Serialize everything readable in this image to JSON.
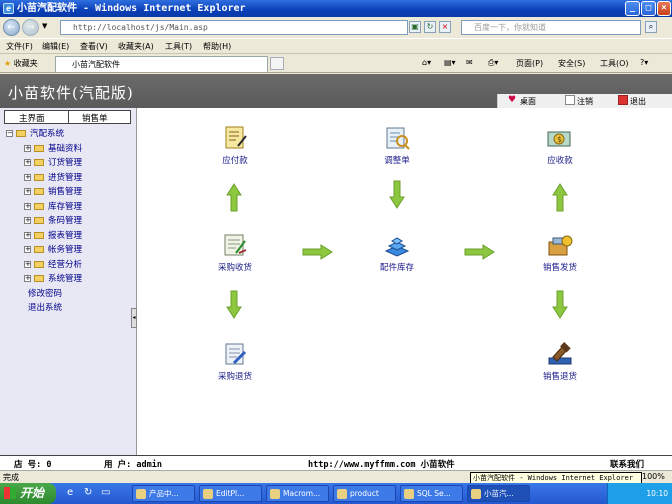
{
  "window": {
    "title": "小苗汽配软件 - Windows Internet Explorer"
  },
  "address": {
    "url": "http://localhost/js/Main.asp",
    "search_placeholder": "百度一下，你就知道"
  },
  "menu": [
    "文件(F)",
    "编辑(E)",
    "查看(V)",
    "收藏夹(A)",
    "工具(T)",
    "帮助(H)"
  ],
  "favorites": {
    "label": "收藏夹",
    "tab_title": "小苗汽配软件"
  },
  "commands": {
    "page": "页面(P)",
    "safety": "安全(S)",
    "tools": "工具(O)"
  },
  "app": {
    "logo": "小苗软件(汽配版)",
    "topnav": {
      "desktop": "桌面",
      "logout": "注销",
      "exit": "退出"
    },
    "left_tabs": [
      "主界面",
      "销售单"
    ],
    "tree": {
      "root": "汽配系统",
      "groups": [
        "基础资料",
        "订货管理",
        "进货管理",
        "销售管理",
        "库存管理",
        "条码管理",
        "报表管理",
        "帐务管理",
        "经营分析",
        "系统管理"
      ],
      "links": [
        "修改密码",
        "退出系统"
      ]
    },
    "flow": {
      "payable": "应付款",
      "adjust": "调整单",
      "receivable": "应收款",
      "purchase_receive": "采购收货",
      "parts_stock": "配件库存",
      "sales_ship": "销售发货",
      "purchase_return": "采购退货",
      "sales_return": "销售退货"
    },
    "status": {
      "store_label": "店 号: 0",
      "user_label": "用 户: admin",
      "site": "http://www.myffmm.com 小苗软件",
      "contact": "联系我们"
    }
  },
  "ie_status": {
    "text": "完成",
    "zoom": "100%"
  },
  "tooltip": "小苗汽配软件 - Windows Internet Explorer",
  "taskbar": {
    "start": "开始",
    "tasks": [
      "产品中...",
      "EditPl...",
      "Macrom...",
      "product",
      "SQL Se...",
      "小苗汽..."
    ],
    "clock": "10:10"
  }
}
